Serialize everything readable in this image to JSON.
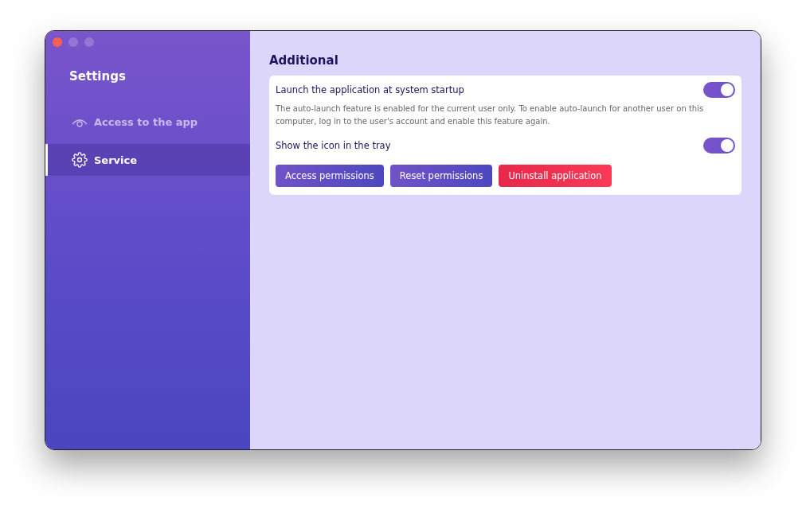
{
  "sidebar": {
    "title": "Settings",
    "items": [
      {
        "label": "Access to the app",
        "kind": "eye",
        "selected": false
      },
      {
        "label": "Service",
        "kind": "gear",
        "selected": true
      }
    ]
  },
  "section": {
    "title": "Additional",
    "settings": [
      {
        "label": "Launch the application at system startup",
        "on": true,
        "description": "The auto-launch feature is enabled for the current user only. To enable auto-launch for another user on this computer, log in to the user's account and enable this feature again."
      },
      {
        "label": "Show the icon in the tray",
        "on": true
      }
    ],
    "buttons": [
      {
        "label": "Access permissions",
        "kind": "primary"
      },
      {
        "label": "Reset permissions",
        "kind": "primary"
      },
      {
        "label": "Uninstall application",
        "kind": "danger"
      }
    ]
  }
}
